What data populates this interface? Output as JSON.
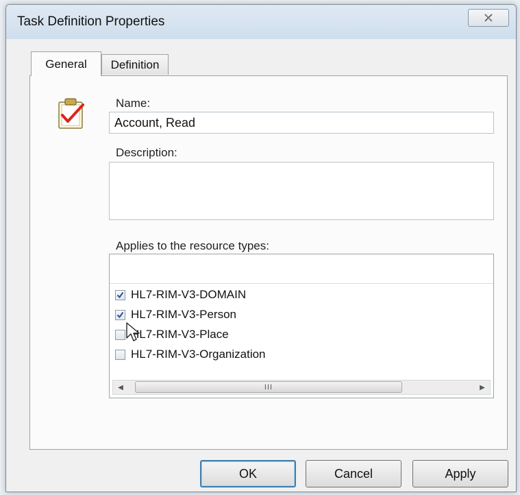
{
  "window": {
    "title": "Task Definition Properties"
  },
  "title_bar": {
    "close_icon": "close-icon"
  },
  "tabs": [
    {
      "label": "General",
      "selected": true
    },
    {
      "label": "Definition",
      "selected": false
    }
  ],
  "general": {
    "icon": "clipboard-checkmark-icon",
    "name_label": "Name:",
    "name_value": "Account, Read",
    "description_label": "Description:",
    "description_value": "",
    "resource_types_label": "Applies to the resource types:",
    "resource_types": [
      {
        "label": "HL7-RIM-V3-DOMAIN",
        "checked": true
      },
      {
        "label": "HL7-RIM-V3-Person",
        "checked": true
      },
      {
        "label": "HL7-RIM-V3-Place",
        "checked": false
      },
      {
        "label": "HL7-RIM-V3-Organization",
        "checked": false
      }
    ],
    "scroll_thumb_grip": "III"
  },
  "buttons": {
    "ok": "OK",
    "cancel": "Cancel",
    "apply": "Apply"
  },
  "colors": {
    "accent": "#3c7fb1",
    "check": "#2a4f9e",
    "clipboard_check": "#d8261c"
  }
}
